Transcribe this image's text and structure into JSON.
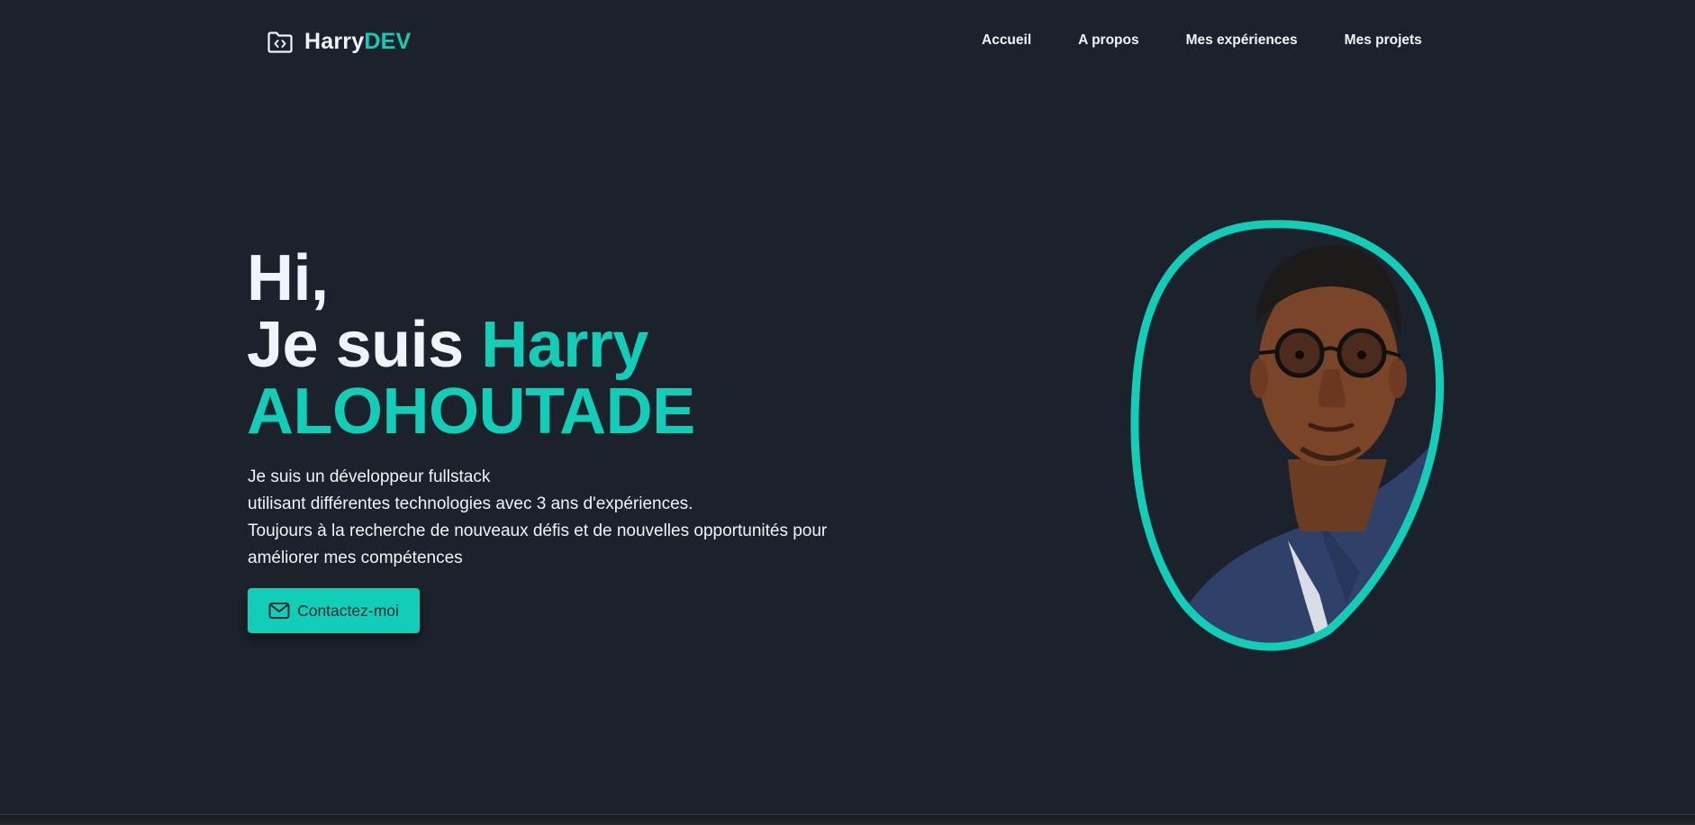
{
  "header": {
    "brand_main": "Harry",
    "brand_accent": "DEV",
    "brand_icon": "folder-code-icon",
    "nav": [
      {
        "label": "Accueil"
      },
      {
        "label": "A propos"
      },
      {
        "label": "Mes expériences"
      },
      {
        "label": "Mes projets"
      }
    ]
  },
  "hero": {
    "greeting": "Hi,",
    "intro": "Je suis ",
    "first_name": "Harry",
    "last_name": "ALOHOUTADE",
    "description": [
      "Je suis un développeur fullstack",
      "utilisant différentes technologies avec 3 ans d'expériences.",
      "Toujours à la recherche de nouveaux défis et de nouvelles opportunités pour",
      "améliorer mes compétences"
    ],
    "cta_label": "Contactez-moi",
    "cta_icon": "mail-icon"
  },
  "portrait": {
    "icon": "profile-photo"
  },
  "colors": {
    "background": "#1c222b",
    "accent": "#12cdb8",
    "text": "#eef5fb"
  }
}
